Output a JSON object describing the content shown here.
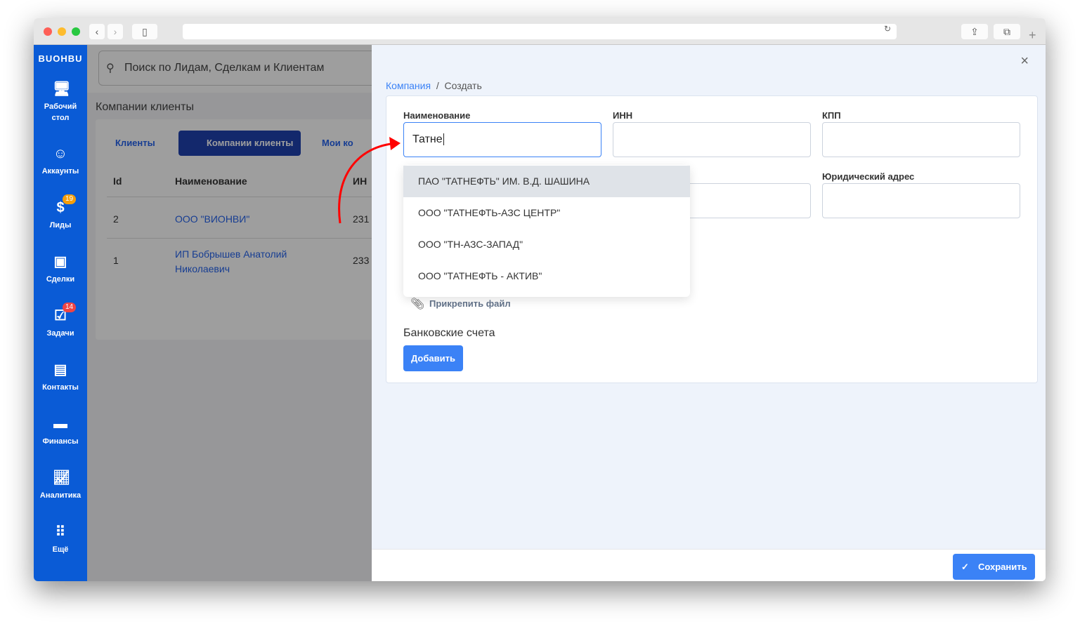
{
  "colors": {
    "sidebar": "#0a5bd6",
    "accent": "#3b82f6",
    "link": "#2563eb"
  },
  "sidebar": {
    "logo": "BUOHBU",
    "items": [
      {
        "label": "Рабочий стол",
        "icon": "monitor-icon"
      },
      {
        "label": "Аккаунты",
        "icon": "smile-icon"
      },
      {
        "label": "Лиды",
        "icon": "money-icon",
        "badge": "19"
      },
      {
        "label": "Сделки",
        "icon": "briefcase-icon"
      },
      {
        "label": "Задачи",
        "icon": "task-icon",
        "badge": "14"
      },
      {
        "label": "Контакты",
        "icon": "contacts-icon"
      },
      {
        "label": "Финансы",
        "icon": "wallet-icon"
      },
      {
        "label": "Аналитика",
        "icon": "chart-icon"
      },
      {
        "label": "Ещё",
        "icon": "more-icon"
      }
    ]
  },
  "search": {
    "placeholder": "Поиск по Лидам, Сделкам и Клиентам"
  },
  "page": {
    "title": "Компании клиенты",
    "tabs": [
      "Клиенты",
      "Компании клиенты",
      "Мои ко"
    ],
    "columns": [
      "Id",
      "Наименование",
      "ИН"
    ],
    "rows": [
      {
        "id": "2",
        "name": "ООО \"ВИОНВИ\"",
        "inn": "231"
      },
      {
        "id": "1",
        "name": "ИП Бобрышев Анатолий Николаевич",
        "inn": "233"
      }
    ]
  },
  "form": {
    "breadcrumb": [
      "Компания",
      "Создать"
    ],
    "labels": {
      "name": "Наименование",
      "inn": "ИНН",
      "kpp": "КПП",
      "address": "Юридический адрес"
    },
    "name_value": "Татне",
    "suggestions": [
      "ПАО \"ТАТНЕФТЬ\" ИМ. В.Д. ШАШИНА",
      "ООО \"ТАТНЕФТЬ-АЗС ЦЕНТР\"",
      "ООО \"ТН-АЗС-ЗАПАД\"",
      "ООО \"ТАТНЕФТЬ - АКТИВ\""
    ],
    "attach": "Прикрепить файл",
    "bank_title": "Банковские счета",
    "add": "Добавить",
    "save": "Сохранить"
  }
}
